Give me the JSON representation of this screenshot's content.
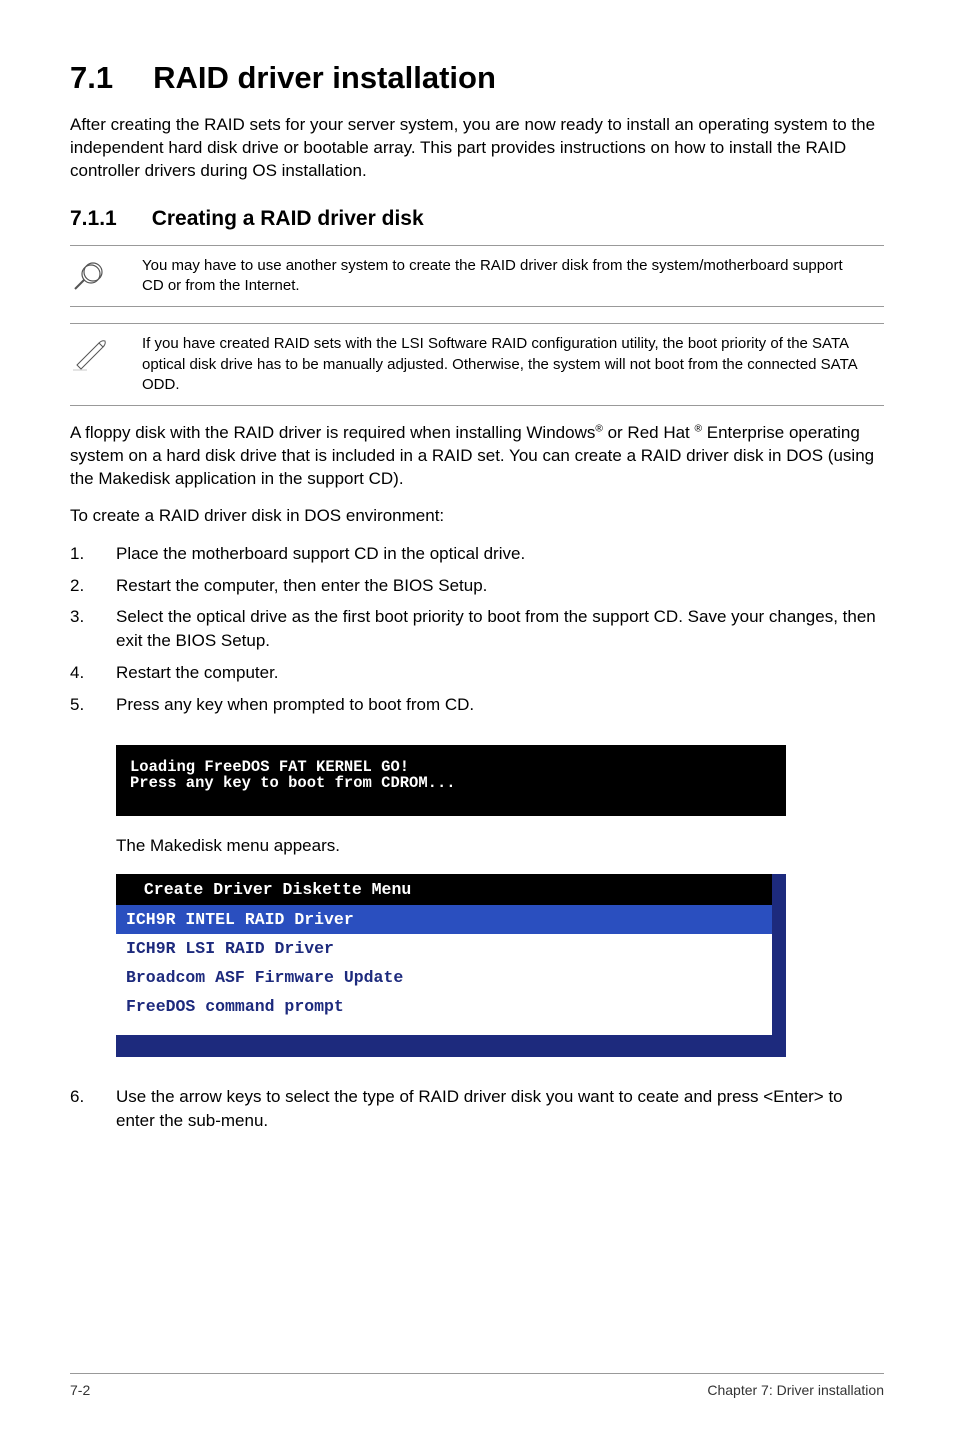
{
  "heading": {
    "number": "7.1",
    "title": "RAID driver installation"
  },
  "intro": "After creating the RAID sets for your server system, you are now ready to install an operating system to the independent hard disk drive or bootable array. This part provides instructions on how to install the RAID controller drivers during OS installation.",
  "subheading": {
    "number": "7.1.1",
    "title": "Creating a RAID driver disk"
  },
  "note1": "You may have to use another system to create the RAID driver disk from the system/motherboard support CD or from the Internet.",
  "note2": "If you have created RAID sets with the LSI Software RAID configuration utility, the boot priority of the SATA optical disk drive has to be manually adjusted. Otherwise, the system will not boot from the connected SATA ODD.",
  "para1_pre": "A floppy disk with the RAID driver is required when installing Windows",
  "para1_mid": " or Red Hat ",
  "para1_post": " Enterprise operating system on a hard disk drive that is included in a RAID set. You can create a RAID driver disk in DOS (using the Makedisk application in the support CD).",
  "para2": "To create a RAID driver disk in DOS environment:",
  "steps_a": [
    "Place the motherboard support CD in the optical drive.",
    "Restart the computer, then enter the BIOS Setup.",
    "Select the optical drive as the first boot priority to boot from the support CD. Save your changes, then exit the BIOS Setup.",
    "Restart the computer.",
    "Press any key when prompted to boot from CD."
  ],
  "terminal": {
    "line1": "Loading FreeDOS FAT KERNEL GO!",
    "line2": "Press any key to boot from CDROM..."
  },
  "makedisk_caption": "The Makedisk menu appears.",
  "menu": {
    "header": "Create Driver Diskette Menu",
    "items": [
      "ICH9R INTEL RAID Driver",
      "ICH9R LSI RAID Driver",
      "Broadcom ASF Firmware Update",
      "FreeDOS command prompt"
    ]
  },
  "step6": "Use the arrow keys to select the type of RAID driver disk you want to ceate and press <Enter> to enter the sub-menu.",
  "footer": {
    "left": "7-2",
    "right": "Chapter 7: Driver installation"
  }
}
